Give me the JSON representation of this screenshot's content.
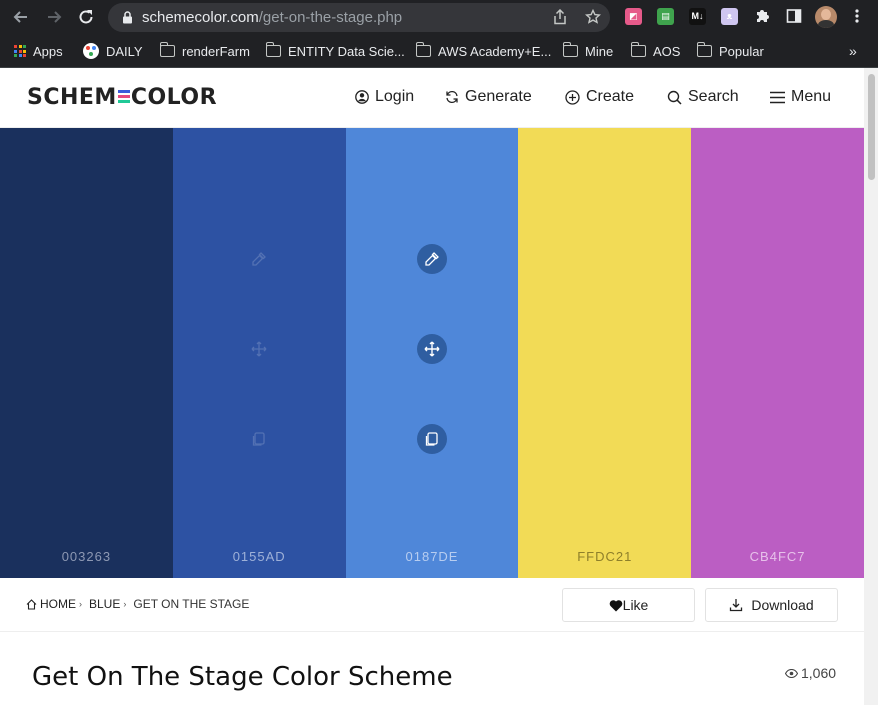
{
  "browser": {
    "url_host": "schemecolor.com",
    "url_path": "/get-on-the-stage.php",
    "bookmarks": [
      {
        "label": "Apps",
        "icon": "apps-grid-icon"
      },
      {
        "label": "DAILY",
        "icon": "daily-icon"
      },
      {
        "label": "renderFarm",
        "icon": "folder-icon"
      },
      {
        "label": "ENTITY Data Scie...",
        "icon": "folder-icon"
      },
      {
        "label": "AWS Academy+E...",
        "icon": "folder-icon"
      },
      {
        "label": "Mine",
        "icon": "folder-icon"
      },
      {
        "label": "AOS",
        "icon": "folder-icon"
      },
      {
        "label": "Popular",
        "icon": "folder-icon"
      }
    ],
    "extensions": [
      {
        "name": "chart-extension-icon",
        "color": "#e65a8a",
        "glyph": "◩"
      },
      {
        "name": "printer-extension-icon",
        "color": "#3fa34d",
        "glyph": "▤"
      },
      {
        "name": "markdown-extension-icon",
        "color": "#111111",
        "glyph": "M↓"
      },
      {
        "name": "cat-extension-icon",
        "color": "#cfc6f0",
        "glyph": "ᴥ"
      }
    ]
  },
  "site": {
    "logo_left": "SCHEM",
    "logo_right": "COLOR",
    "logo_bar_colors": [
      "#3b5bdb",
      "#e64980",
      "#20c997"
    ],
    "nav": [
      {
        "label": "Login",
        "icon": "user-icon"
      },
      {
        "label": "Generate",
        "icon": "refresh-icon"
      },
      {
        "label": "Create",
        "icon": "plus-circle-icon"
      },
      {
        "label": "Search",
        "icon": "search-icon"
      },
      {
        "label": "Menu",
        "icon": "hamburger-icon"
      }
    ]
  },
  "palette": [
    {
      "hex": "003263",
      "color": "#1a305d",
      "label_color": "#8d98b3"
    },
    {
      "hex": "0155AD",
      "color": "#2d52a3",
      "label_color": "#9eb1d8"
    },
    {
      "hex": "0187DE",
      "color": "#4f87d9",
      "label_color": "#b7cdf0"
    },
    {
      "hex": "FFDC21",
      "color": "#f2db56",
      "label_color": "#8e7f2a"
    },
    {
      "hex": "CB4FC7",
      "color": "#bb5ec3",
      "label_color": "#e7c1ea"
    }
  ],
  "breadcrumb": {
    "home": "HOME",
    "category": "BLUE",
    "current": "GET ON THE STAGE"
  },
  "actions": {
    "like_label": "Like",
    "download_label": "Download"
  },
  "scheme": {
    "title": "Get On The Stage Color Scheme",
    "views": "1,060"
  }
}
